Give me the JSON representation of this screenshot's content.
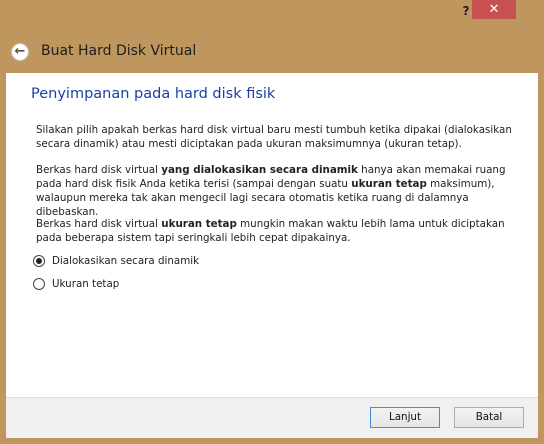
{
  "window": {
    "help_label": "?",
    "close_label": "✕",
    "title": "Buat Hard Disk Virtual"
  },
  "content": {
    "heading": "Penyimpanan pada hard disk fisik",
    "p1": "Silakan pilih apakah berkas hard disk virtual baru mesti tumbuh ketika dipakai (dialokasikan secara dinamik) atau mesti diciptakan pada ukuran maksimumnya (ukuran tetap).",
    "p2": {
      "a": "Berkas hard disk virtual ",
      "b": "yang dialokasikan secara dinamik",
      "c": " hanya akan memakai ruang pada hard disk fisik Anda ketika terisi (sampai dengan suatu ",
      "d": "ukuran tetap",
      "e": " maksimum), walaupun mereka tak akan mengecil lagi secara otomatis ketika ruang di dalamnya dibebaskan."
    },
    "p3": {
      "a": "Berkas hard disk virtual ",
      "b": "ukuran tetap",
      "c": " mungkin makan waktu lebih lama untuk diciptakan pada beberapa sistem tapi seringkali lebih cepat dipakainya."
    },
    "options": [
      {
        "label": "Dialokasikan secara dinamik",
        "selected": true
      },
      {
        "label": "Ukuran tetap",
        "selected": false
      }
    ]
  },
  "footer": {
    "next_label": "Lanjut",
    "cancel_label": "Batal"
  }
}
